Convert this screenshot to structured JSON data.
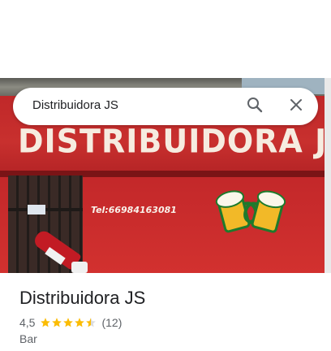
{
  "search": {
    "query": "Distribuidora JS"
  },
  "hero": {
    "sign_text": "DISTRIBUIDORA JS",
    "phone_text": "Tel:66984163081"
  },
  "place": {
    "title": "Distribuidora JS",
    "rating": "4,5",
    "stars": 4.5,
    "review_count": "(12)",
    "category": "Bar"
  },
  "colors": {
    "star": "#fbbc04",
    "text_primary": "#202124",
    "text_secondary": "#5f6368"
  },
  "icons": {
    "search": "search-icon",
    "close": "close-icon"
  }
}
